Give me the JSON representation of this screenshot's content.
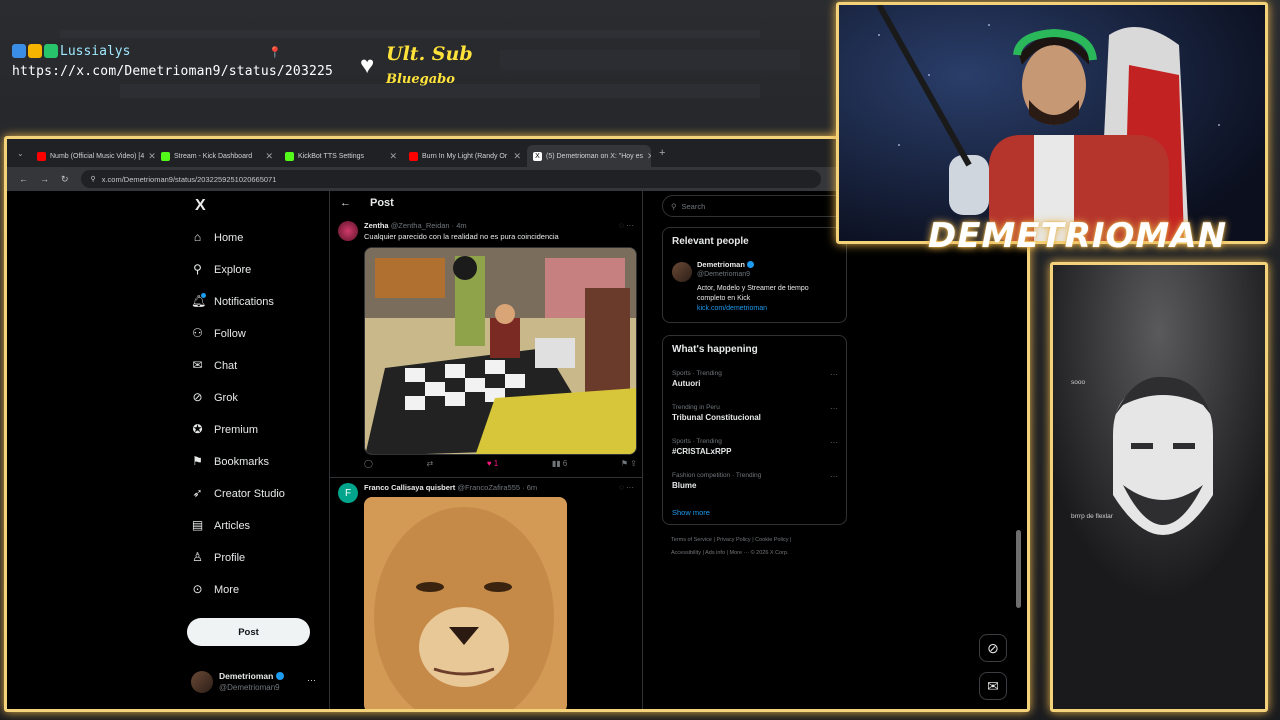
{
  "overlay": {
    "username": "Lussialys",
    "url": "https://x.com/Demetrioman9/status/203225",
    "ult_sub_title": "Ult. Sub",
    "ult_sub_name": "Bluegabo",
    "streamer_name": "DEMETRIOMAN"
  },
  "browser": {
    "tabs": [
      {
        "label": "Numb (Official Music Video) [4",
        "color": "#ff0000"
      },
      {
        "label": "Stream - Kick Dashboard",
        "color": "#53fc18"
      },
      {
        "label": "KickBot TTS Settings",
        "color": "#53fc18"
      },
      {
        "label": "Burn In My Light (Randy Or",
        "color": "#ff0000"
      },
      {
        "label": "(5) Demetrioman on X: \"Hoy es",
        "color": "#ffffff"
      }
    ],
    "url": "x.com/Demetrioman9/status/2032259251020665071"
  },
  "nav": {
    "logo": "X",
    "items": [
      {
        "label": "Home",
        "icon": "home-icon"
      },
      {
        "label": "Explore",
        "icon": "search-icon"
      },
      {
        "label": "Notifications",
        "icon": "bell-icon"
      },
      {
        "label": "Follow",
        "icon": "follow-icon"
      },
      {
        "label": "Chat",
        "icon": "mail-icon"
      },
      {
        "label": "Grok",
        "icon": "grok-icon"
      },
      {
        "label": "Premium",
        "icon": "premium-icon"
      },
      {
        "label": "Bookmarks",
        "icon": "bookmark-icon"
      },
      {
        "label": "Creator Studio",
        "icon": "rocket-icon"
      },
      {
        "label": "Articles",
        "icon": "article-icon"
      },
      {
        "label": "Profile",
        "icon": "user-icon"
      },
      {
        "label": "More",
        "icon": "more-icon"
      }
    ],
    "post_button": "Post",
    "account": {
      "name": "Demetrioman",
      "handle": "@Demetrioman9"
    }
  },
  "timeline": {
    "header": "Post",
    "posts": [
      {
        "name": "Zentha",
        "handle": "@Zentha_Reidan",
        "time": "4m",
        "text": "Cualquier parecido con la realidad no es pura coincidencia",
        "likes": "1",
        "views": "6"
      },
      {
        "name": "Franco Callisaya quisbert",
        "handle": "@FrancoZafira555",
        "time": "6m",
        "avatar_letter": "F"
      }
    ]
  },
  "sidebar": {
    "search_placeholder": "Search",
    "relevant_title": "Relevant people",
    "relevant_person": {
      "name": "Demetrioman",
      "handle": "@Demetrioman9",
      "bio": "Actor, Modelo y Streamer de tiempo completo en Kick",
      "link": "kick.com/demetrioman"
    },
    "happening_title": "What's happening",
    "trends": [
      {
        "context": "Sports · Trending",
        "name": "Autuori"
      },
      {
        "context": "Trending in Peru",
        "name": "Tribunal Constitucional"
      },
      {
        "context": "Sports · Trending",
        "name": "#CRISTALxRPP"
      },
      {
        "context": "Fashion competition · Trending",
        "name": "Blume"
      }
    ],
    "show_more": "Show more",
    "footer1": "Terms of Service  |  Privacy Policy  |  Cookie Policy  |",
    "footer2": "Accessibility  |  Ads info  |  More ···  © 2026 X Corp."
  },
  "chat": {
    "lines": [
      "",
      "",
      "",
      "",
      "",
      "sooo",
      "",
      "",
      "",
      "",
      "",
      "",
      "brrrp de flexlar",
      "",
      "",
      "",
      "",
      "",
      "",
      "",
      "",
      ""
    ]
  },
  "colors": {
    "accent_frame": "#f4d27a",
    "x_blue": "#1d9bf0",
    "like_pink": "#f91880"
  }
}
